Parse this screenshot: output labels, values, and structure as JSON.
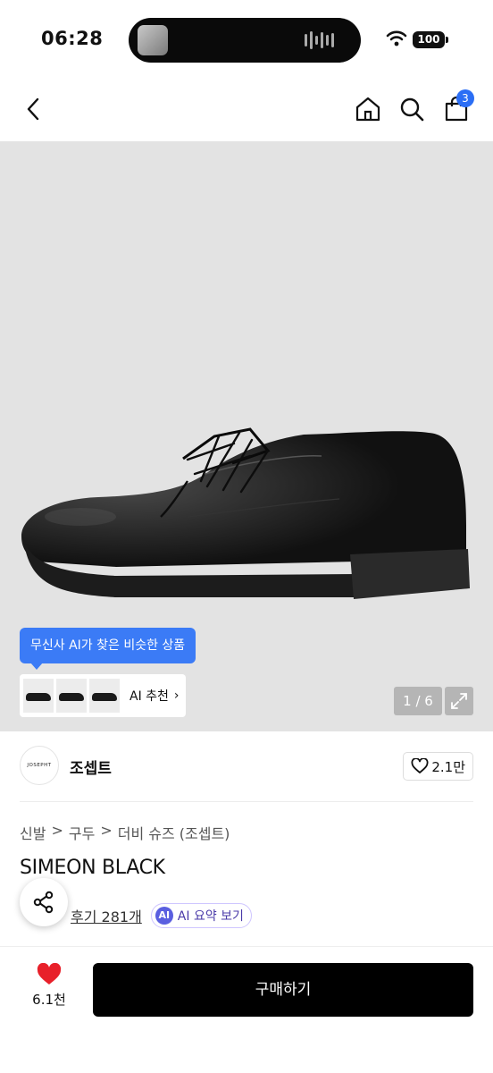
{
  "status_bar": {
    "time": "06:28",
    "battery": "100"
  },
  "nav": {
    "cart_count": "3",
    "icons": [
      "chevron-left-icon",
      "home-icon",
      "search-icon",
      "shopping-bag-icon"
    ]
  },
  "gallery": {
    "ai_tooltip": "무신사 AI가 찾은 비슷한 상품",
    "ai_recommend_label": "AI 추천",
    "ai_recommend_chevron": "›",
    "page_indicator": "1 / 6"
  },
  "brand": {
    "logo_text": "JOSEPHT",
    "name": "조셉트",
    "likes": "2.1만"
  },
  "breadcrumb": [
    "신발",
    ">",
    "구두",
    ">",
    "더비 슈즈 (조셉트)"
  ],
  "product": {
    "title": "SIMEON BLACK"
  },
  "reviews": {
    "link": "후기 281개",
    "ai_chip": "AI",
    "ai_summary": "AI 요약 보기"
  },
  "bottom_bar": {
    "wish_count": "6.1천",
    "buy_label": "구매하기"
  },
  "colors": {
    "accent_blue": "#2b6ef5",
    "wish_red": "#e8202a",
    "buy_bg": "#000000",
    "hero_bg": "#e3e3e3"
  }
}
